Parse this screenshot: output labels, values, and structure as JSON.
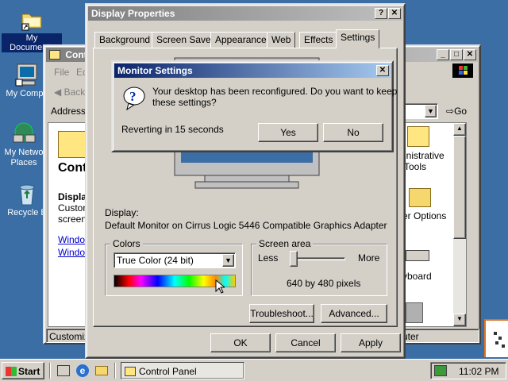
{
  "desktop": {
    "icons": [
      {
        "label": "My Documents"
      },
      {
        "label": "My Compu"
      },
      {
        "label": "My Netwo Places"
      },
      {
        "label": "Recycle B"
      }
    ]
  },
  "control_panel": {
    "title": "Contr",
    "menu_file": "File",
    "menu_edit": "Ed",
    "back_label": "Back",
    "address_label": "Address",
    "go_label": "Go",
    "heading": "Cont",
    "subheading": "Displa",
    "desc_line1": "Custom",
    "desc_line2": "screen",
    "link1": "Window",
    "link2": "Window",
    "right_items": [
      "inistrative",
      "Tools",
      "er Options",
      "yboard"
    ],
    "status_left": "Customize",
    "status_right": "uter"
  },
  "display_properties": {
    "title": "Display Properties",
    "tabs": [
      "Background",
      "Screen Saver",
      "Appearance",
      "Web",
      "Effects",
      "Settings"
    ],
    "active_tab": "Settings",
    "display_label": "Display:",
    "display_value": "Default Monitor on Cirrus Logic 5446 Compatible Graphics Adapter",
    "colors_label": "Colors",
    "colors_value": "True Color (24 bit)",
    "screen_area_label": "Screen area",
    "less_label": "Less",
    "more_label": "More",
    "resolution": "640 by 480 pixels",
    "resolution_slider_fraction": 0.0,
    "troubleshoot": "Troubleshoot...",
    "advanced": "Advanced...",
    "ok": "OK",
    "cancel": "Cancel",
    "apply": "Apply"
  },
  "monitor_dialog": {
    "title": "Monitor Settings",
    "message_line1": "Your desktop has been reconfigured.  Do you want to keep",
    "message_line2": "these settings?",
    "countdown": "Reverting in 15 seconds",
    "yes": "Yes",
    "no": "No"
  },
  "taskbar": {
    "start": "Start",
    "task_label": "Control Panel",
    "clock": "11:02 PM"
  },
  "colors": {
    "desktop": "#3a6ea5",
    "title_active": "#0a246a",
    "face": "#d4d0c8"
  }
}
